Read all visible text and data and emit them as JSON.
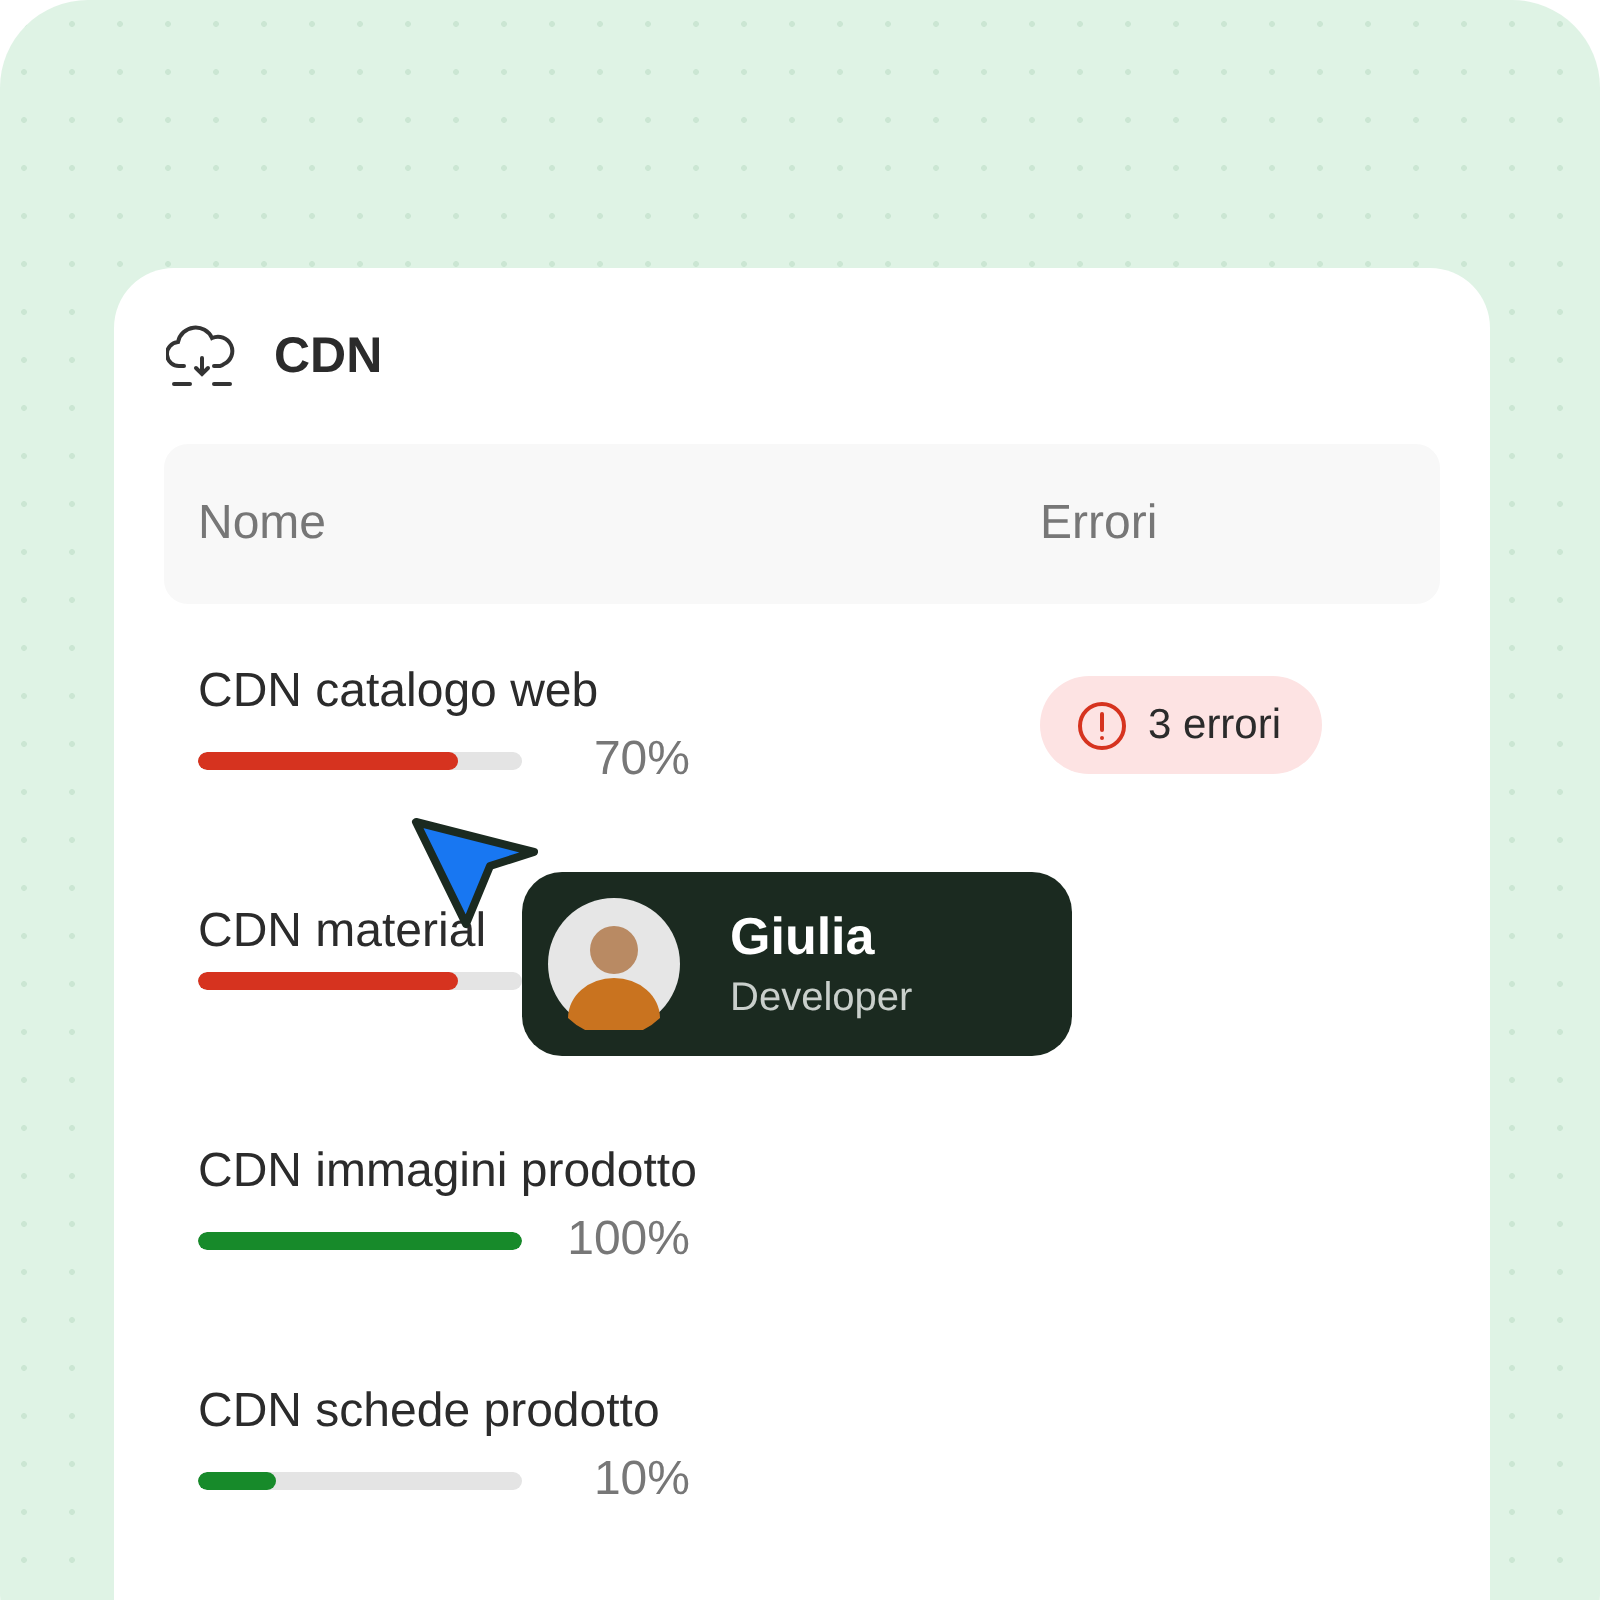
{
  "panel": {
    "title": "CDN"
  },
  "table": {
    "columns": [
      "Nome",
      "Errori"
    ],
    "rows": [
      {
        "name": "CDN catalogo web",
        "level": 0.8,
        "percent": "70%",
        "color": "#d6331f",
        "errors": "3 errori"
      },
      {
        "name": "CDN material",
        "level": 0.8,
        "color": "#d6331f"
      },
      {
        "name": "CDN immagini prodotto",
        "level": 1,
        "percent": "100%",
        "color": "#178a2a"
      },
      {
        "name": "CDN schede prodotto",
        "level": 0.24,
        "percent": "10%",
        "color": "#178a2a"
      }
    ]
  },
  "tooltip": {
    "name": "Giulia",
    "role": "Developer"
  }
}
